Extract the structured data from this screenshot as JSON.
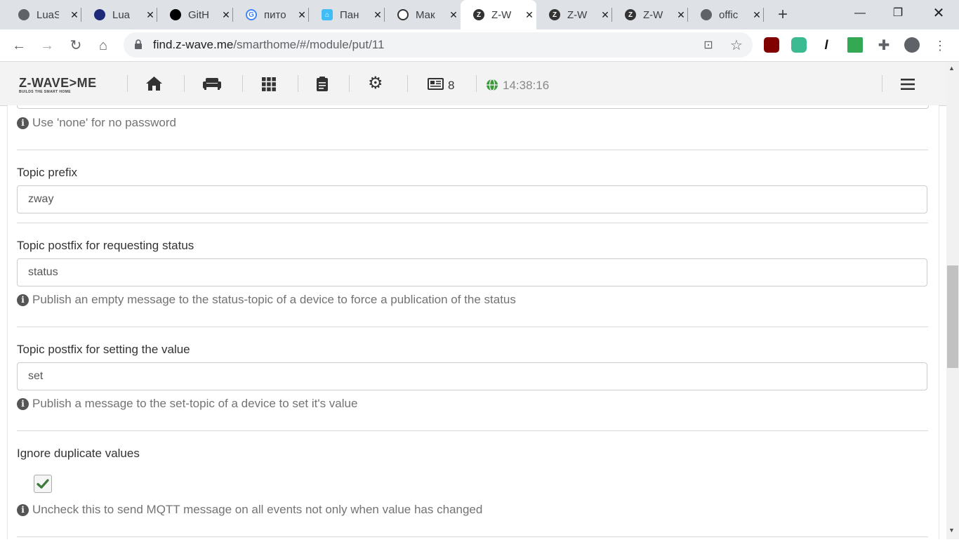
{
  "browser": {
    "tabs": [
      {
        "title": "LuaS",
        "favicon_color": "#5f6368",
        "icon": "globe-icon"
      },
      {
        "title": "Lua",
        "favicon_color": "#1e2a78",
        "icon": "lua-icon"
      },
      {
        "title": "GitH",
        "favicon_color": "#000000",
        "icon": "github-icon"
      },
      {
        "title": "пито",
        "favicon_color": "#4285f4",
        "icon": "google-icon"
      },
      {
        "title": "Пан",
        "favicon_color": "#41bdf5",
        "icon": "home-assistant-icon"
      },
      {
        "title": "Мак",
        "favicon_color": "#333333",
        "icon": "owl-icon"
      },
      {
        "title": "Z-W",
        "favicon_color": "#333333",
        "icon": "zwave-icon"
      },
      {
        "title": "Z-W",
        "favicon_color": "#333333",
        "icon": "zwave-icon"
      },
      {
        "title": "Z-W",
        "favicon_color": "#333333",
        "icon": "zwave-icon"
      },
      {
        "title": "offic",
        "favicon_color": "#5f6368",
        "icon": "globe-icon"
      }
    ],
    "url_host": "find.z-wave.me",
    "url_path": "/smarthome/#/module/put/11"
  },
  "app": {
    "logo_text": "Z-WAVE>ME",
    "logo_tagline": "BUILDS THE SMART HOME",
    "notifications_count": "8",
    "time": "14:38:16"
  },
  "form": {
    "password_help": "Use 'none' for no password",
    "topic_prefix": {
      "label": "Topic prefix",
      "value": "zway"
    },
    "status_postfix": {
      "label": "Topic postfix for requesting status",
      "value": "status",
      "help": "Publish an empty message to the status-topic of a device to force a publication of the status"
    },
    "set_postfix": {
      "label": "Topic postfix for setting the value",
      "value": "set",
      "help": "Publish a message to the set-topic of a device to set it's value"
    },
    "ignore_duplicates": {
      "label": "Ignore duplicate values",
      "checked": true,
      "help": "Uncheck this to send MQTT message on all events not only when value has changed"
    }
  }
}
